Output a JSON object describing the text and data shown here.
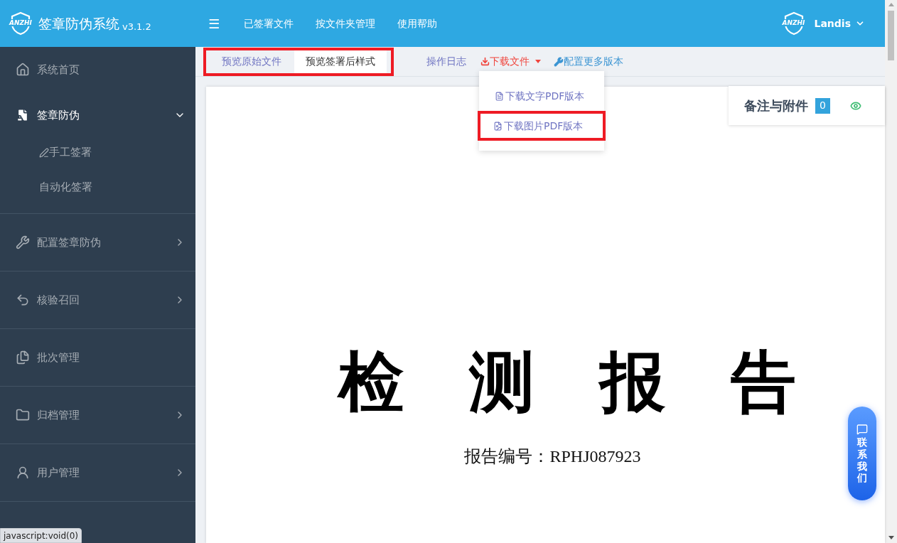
{
  "header": {
    "logo_text": "ANZHI",
    "title": "签章防伪系统",
    "version": "v3.1.2",
    "menu_icon": "☰",
    "nav": [
      "已签署文件",
      "按文件夹管理",
      "使用帮助"
    ],
    "user": {
      "avatar_text": "ANZHI",
      "name": "Landis"
    }
  },
  "sidebar": {
    "items": [
      {
        "label": "系统首页",
        "active": false,
        "expandable": false
      },
      {
        "label": "签章防伪",
        "active": true,
        "expandable": true,
        "expanded": true,
        "children": [
          {
            "label": "手工签署"
          },
          {
            "label": "自动化签署"
          }
        ]
      },
      {
        "label": "配置签章防伪",
        "active": false,
        "expandable": true,
        "expanded": false
      },
      {
        "label": "核验召回",
        "active": false,
        "expandable": true,
        "expanded": false
      },
      {
        "label": "批次管理",
        "active": false,
        "expandable": false
      },
      {
        "label": "归档管理",
        "active": false,
        "expandable": true,
        "expanded": false
      },
      {
        "label": "用户管理",
        "active": false,
        "expandable": true,
        "expanded": false
      }
    ]
  },
  "toolbar": {
    "tabs_highlighted": true,
    "tabs": [
      {
        "label": "预览原始文件",
        "selected": false
      },
      {
        "label": "预览签署后样式",
        "selected": true
      }
    ],
    "actions": [
      {
        "kind": "plain",
        "label": "操作日志",
        "open": false
      },
      {
        "kind": "dropdown",
        "label": "下载文件",
        "open": true
      },
      {
        "kind": "config",
        "label": "配置更多版本",
        "open": false
      }
    ],
    "menu": [
      {
        "label": "下载文字PDF版本",
        "highlighted": false
      },
      {
        "label": "下载图片PDF版本",
        "highlighted": true
      }
    ]
  },
  "document": {
    "title": "检　测　报　告",
    "number": "报告编号：RPHJ087923"
  },
  "notes_panel": {
    "title": "备注与附件",
    "count": "0",
    "visible": true
  },
  "contact_button": {
    "label": "联系我们"
  },
  "status_tooltip": "javascript:void(0)"
}
